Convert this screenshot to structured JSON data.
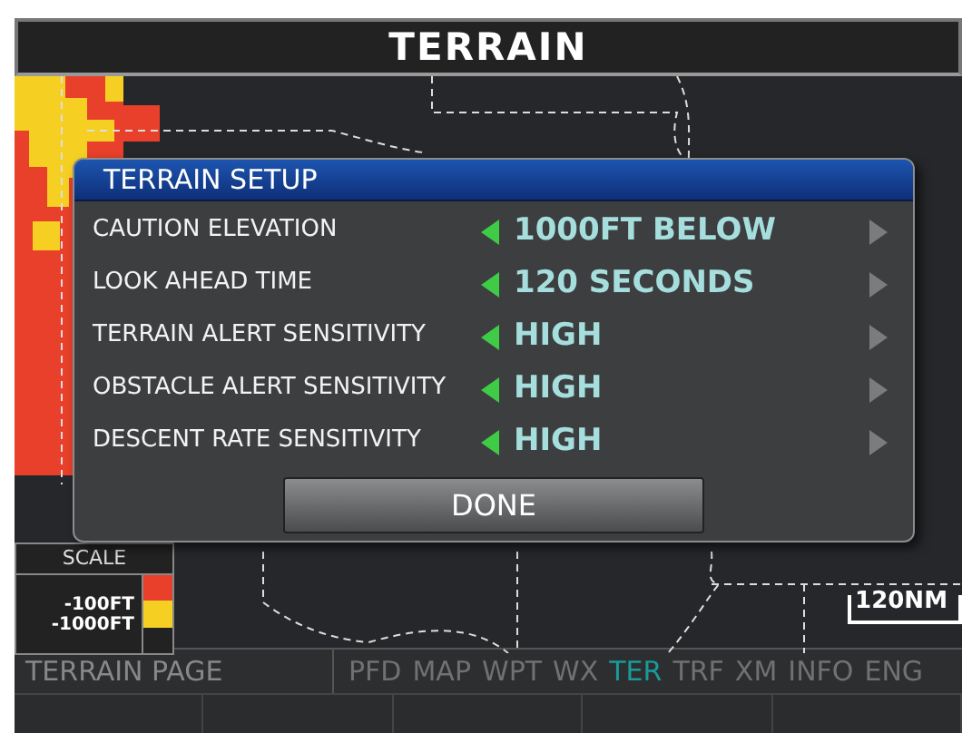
{
  "title": "TERRAIN",
  "setup": {
    "title": "TERRAIN SETUP",
    "rows": [
      {
        "label": "CAUTION ELEVATION",
        "value": "1000FT BELOW"
      },
      {
        "label": "LOOK AHEAD TIME",
        "value": "120 SECONDS"
      },
      {
        "label": "TERRAIN ALERT SENSITIVITY",
        "value": "HIGH"
      },
      {
        "label": "OBSTACLE ALERT SENSITIVITY",
        "value": "HIGH"
      },
      {
        "label": "DESCENT RATE SENSITIVITY",
        "value": "HIGH"
      }
    ],
    "button": "DONE"
  },
  "legend": {
    "title": "SCALE",
    "items": [
      {
        "label": "-100FT",
        "color": "#e8402a"
      },
      {
        "label": "-1000FT",
        "color": "#f5d023"
      }
    ]
  },
  "scale": "120NM",
  "page_name": "TERRAIN PAGE",
  "pages": [
    {
      "label": "PFD",
      "selected": false
    },
    {
      "label": "MAP",
      "selected": false
    },
    {
      "label": "WPT",
      "selected": false
    },
    {
      "label": "WX",
      "selected": false
    },
    {
      "label": "TER",
      "selected": true
    },
    {
      "label": "TRF",
      "selected": false
    },
    {
      "label": "XM",
      "selected": false
    },
    {
      "label": "INFO",
      "selected": false
    },
    {
      "label": "ENG",
      "selected": false
    }
  ]
}
